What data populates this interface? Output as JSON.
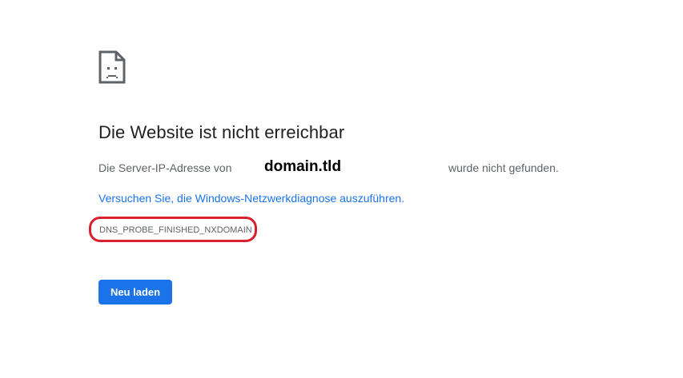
{
  "error_page": {
    "title": "Die Website ist nicht erreichbar",
    "message_prefix": "Die Server-IP-Adresse von",
    "domain": "domain.tld",
    "message_suffix": "wurde nicht gefunden.",
    "diagnostics_link": "Versuchen Sie, die Windows-Netzwerkdiagnose auszuführen.",
    "error_code": "DNS_PROBE_FINISHED_NXDOMAIN",
    "reload_button": "Neu laden",
    "icon": "sad-document-icon"
  },
  "colors": {
    "link": "#1a73e8",
    "button": "#1a73e8",
    "highlight_outline": "#d9202e"
  }
}
